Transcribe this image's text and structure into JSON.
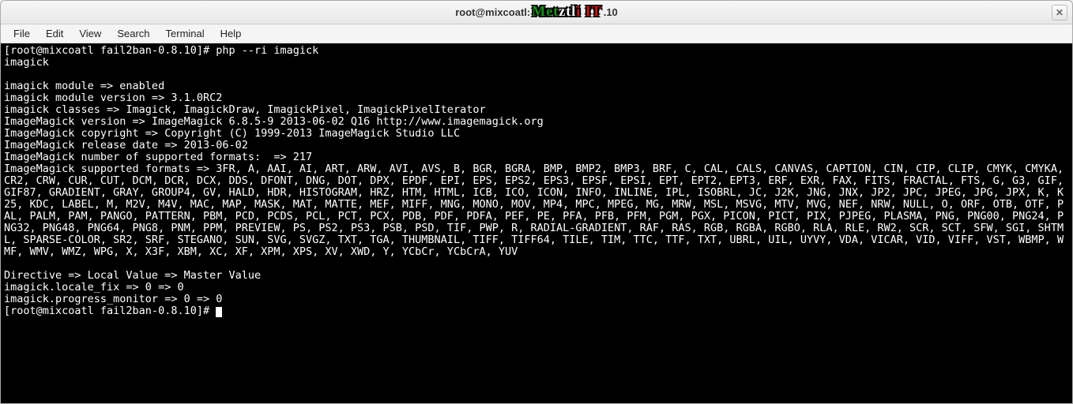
{
  "window": {
    "title_left": "root@mixcoatl:",
    "title_right": ".10",
    "logo_text": "Metztli IT"
  },
  "menubar": {
    "items": [
      "File",
      "Edit",
      "View",
      "Search",
      "Terminal",
      "Help"
    ]
  },
  "terminal": {
    "prompt1_prefix": "[root@mixcoatl fail2ban-0.8.10]# ",
    "command": "php --ri imagick",
    "body": "\nimagick\n\nimagick module => enabled\nimagick module version => 3.1.0RC2\nimagick classes => Imagick, ImagickDraw, ImagickPixel, ImagickPixelIterator\nImageMagick version => ImageMagick 6.8.5-9 2013-06-02 Q16 http://www.imagemagick.org\nImageMagick copyright => Copyright (C) 1999-2013 ImageMagick Studio LLC\nImageMagick release date => 2013-06-02\nImageMagick number of supported formats:  => 217\nImageMagick supported formats => 3FR, A, AAI, AI, ART, ARW, AVI, AVS, B, BGR, BGRA, BMP, BMP2, BMP3, BRF, C, CAL, CALS, CANVAS, CAPTION, CIN, CIP, CLIP, CMYK, CMYKA, CR2, CRW, CUR, CUT, DCM, DCR, DCX, DDS, DFONT, DNG, DOT, DPX, EPDF, EPI, EPS, EPS2, EPS3, EPSF, EPSI, EPT, EPT2, EPT3, ERF, EXR, FAX, FITS, FRACTAL, FTS, G, G3, GIF, GIF87, GRADIENT, GRAY, GROUP4, GV, HALD, HDR, HISTOGRAM, HRZ, HTM, HTML, ICB, ICO, ICON, INFO, INLINE, IPL, ISOBRL, JC, J2K, JNG, JNX, JP2, JPC, JPEG, JPG, JPX, K, K25, KDC, LABEL, M, M2V, M4V, MAC, MAP, MASK, MAT, MATTE, MEF, MIFF, MNG, MONO, MOV, MP4, MPC, MPEG, MG, MRW, MSL, MSVG, MTV, MVG, NEF, NRW, NULL, O, ORF, OTB, OTF, PAL, PALM, PAM, PANGO, PATTERN, PBM, PCD, PCDS, PCL, PCT, PCX, PDB, PDF, PDFA, PEF, PE, PFA, PFB, PFM, PGM, PGX, PICON, PICT, PIX, PJPEG, PLASMA, PNG, PNG00, PNG24, PNG32, PNG48, PNG64, PNG8, PNM, PPM, PREVIEW, PS, PS2, PS3, PSB, PSD, TIF, PWP, R, RADIAL-GRADIENT, RAF, RAS, RGB, RGBA, RGBO, RLA, RLE, RW2, SCR, SCT, SFW, SGI, SHTML, SPARSE-COLOR, SR2, SRF, STEGANO, SUN, SVG, SVGZ, TXT, TGA, THUMBNAIL, TIFF, TIFF64, TILE, TIM, TTC, TTF, TXT, UBRL, UIL, UYVY, VDA, VICAR, VID, VIFF, VST, WBMP, WMF, WMV, WMZ, WPG, X, X3F, XBM, XC, XF, XPM, XPS, XV, XWD, Y, YCbCr, YCbCrA, YUV\n\nDirective => Local Value => Master Value\nimagick.locale_fix => 0 => 0\nimagick.progress_monitor => 0 => 0\n",
    "prompt2_prefix": "[root@mixcoatl fail2ban-0.8.10]# "
  }
}
